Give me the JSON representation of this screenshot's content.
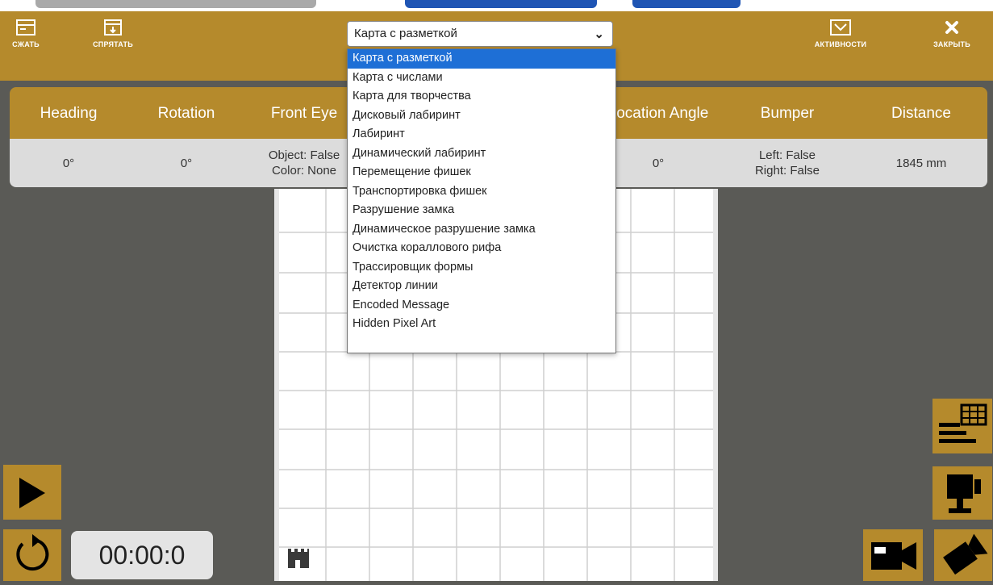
{
  "toolbar": {
    "compress_label": "СЖАТЬ",
    "hide_label": "СПРЯТАТЬ",
    "activities_label": "АКТИВНОСТИ",
    "close_label": "ЗАКРЫТЬ"
  },
  "map_select": {
    "value": "Карта с разметкой",
    "options": [
      "Карта с разметкой",
      "Карта с числами",
      "Карта для творчества",
      "Дисковый лабиринт",
      "Лабиринт",
      "Динамический лабиринт",
      "Перемещение фишек",
      "Транспортировка фишек",
      "Разрушение замка",
      "Динамическое разрушение замка",
      "Очистка кораллового рифа",
      "Трассировщик формы",
      "Детектор линии",
      "Encoded Message",
      "Hidden Pixel Art"
    ],
    "selected_index": 0
  },
  "stats": {
    "headers": [
      "Heading",
      "Rotation",
      "Front Eye",
      "",
      "Location Angle",
      "Bumper",
      "Distance"
    ],
    "values": [
      "0°",
      "0°",
      "Object: False\nColor: None",
      "",
      "0°",
      "Left: False\nRight: False",
      "1845 mm"
    ]
  },
  "timer": "00:00:0",
  "colors": {
    "accent": "#b58a2c",
    "background": "#5a5a56",
    "selected_option": "#1e6fd6"
  },
  "icons": {
    "compress": "compress-icon",
    "hide": "hide-icon",
    "activities": "activities-icon",
    "close": "close-icon",
    "play": "play-icon",
    "reset": "reset-icon",
    "castle": "castle-icon"
  }
}
